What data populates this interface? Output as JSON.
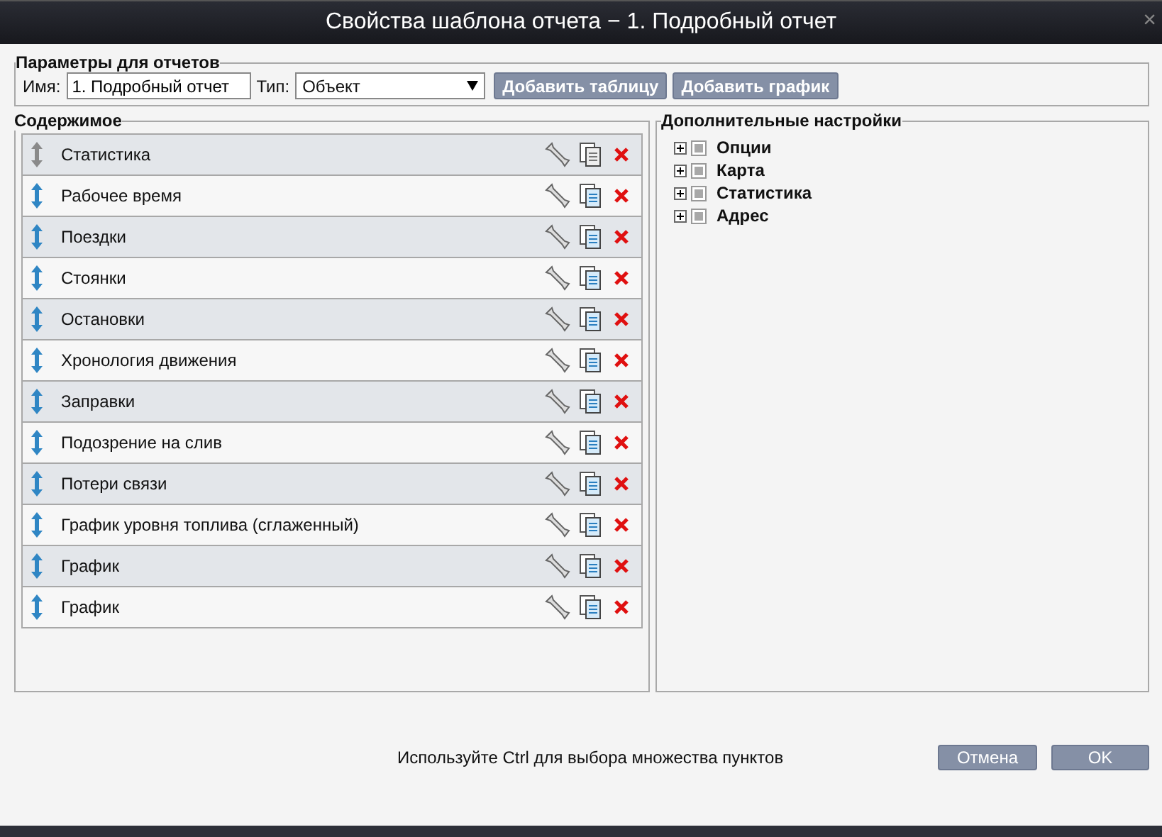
{
  "window": {
    "title": "Свойства шаблона отчета − 1. Подробный отчет",
    "close": "×"
  },
  "params": {
    "legend": "Параметры для отчетов",
    "name_label": "Имя:",
    "name_value": "1. Подробный отчет",
    "type_label": "Тип:",
    "type_value": "Объект",
    "buttons": [
      "Добавить таблицу",
      "Добавить график"
    ]
  },
  "contents": {
    "legend": "Содержимое",
    "items": [
      {
        "label": "Статистика",
        "disabled": true
      },
      {
        "label": "Рабочее время",
        "disabled": false
      },
      {
        "label": "Поездки",
        "disabled": false
      },
      {
        "label": "Стоянки",
        "disabled": false
      },
      {
        "label": "Остановки",
        "disabled": false
      },
      {
        "label": "Хронология движения",
        "disabled": false
      },
      {
        "label": "Заправки",
        "disabled": false
      },
      {
        "label": "Подозрение на слив",
        "disabled": false
      },
      {
        "label": "Потери связи",
        "disabled": false
      },
      {
        "label": "График уровня топлива (сглаженный)",
        "disabled": false
      },
      {
        "label": "График",
        "disabled": false
      },
      {
        "label": "График",
        "disabled": false
      }
    ]
  },
  "settings": {
    "legend": "Дополнительные настройки",
    "items": [
      {
        "label": "Опции",
        "expanded": false,
        "checked": false
      },
      {
        "label": "Карта",
        "expanded": false,
        "checked": false
      },
      {
        "label": "Статистика",
        "expanded": false,
        "checked": false
      },
      {
        "label": "Адрес",
        "expanded": false,
        "checked": false
      }
    ]
  },
  "footer": {
    "hint": "Используйте Ctrl для выбора множества пунктов",
    "buttons": [
      "Отмена",
      "OK"
    ]
  }
}
